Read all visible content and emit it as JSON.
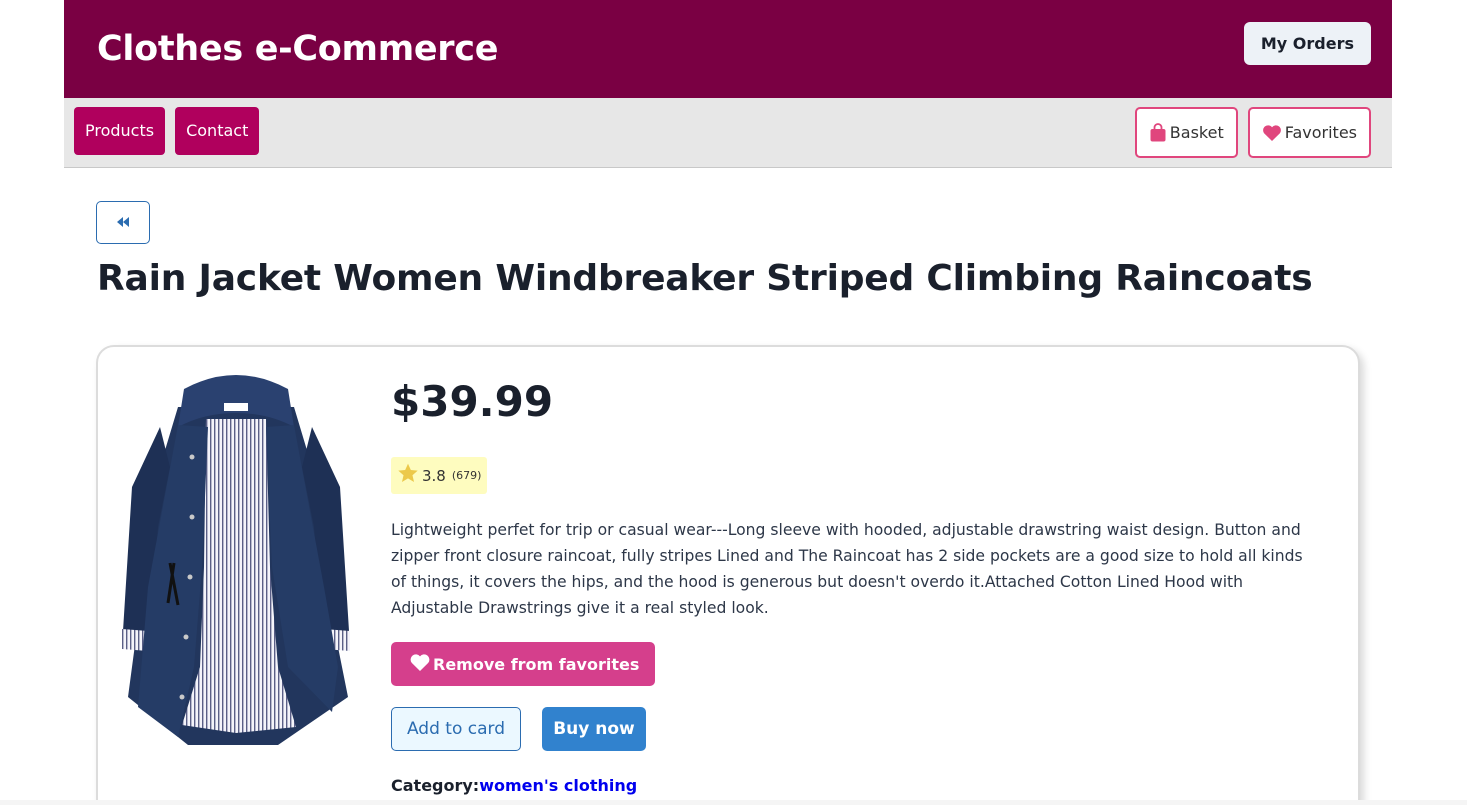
{
  "header": {
    "brand": "Clothes e-Commerce",
    "orders_label": "My Orders"
  },
  "nav": {
    "items": [
      {
        "label": "Products"
      },
      {
        "label": "Contact"
      }
    ],
    "basket_label": "Basket",
    "favorites_label": "Favorites"
  },
  "product": {
    "back_icon": "double-chevron-left-icon",
    "title": "Rain Jacket Women Windbreaker Striped Climbing Raincoats",
    "price": "$39.99",
    "rating": "3.8",
    "rating_count": "(679)",
    "description": "Lightweight perfet for trip or casual wear---Long sleeve with hooded, adjustable drawstring waist design. Button and zipper front closure raincoat, fully stripes Lined and The Raincoat has 2 side pockets are a good size to hold all kinds of things, it covers the hips, and the hood is generous but doesn't overdo it.Attached Cotton Lined Hood with Adjustable Drawstrings give it a real styled look.",
    "remove_fav_label": "Remove from favorites",
    "add_to_card_label": "Add to card",
    "buy_now_label": "Buy now",
    "category_label": "Category:",
    "category_value": "women's clothing"
  },
  "colors": {
    "header_bg": "#7a0043",
    "nav_button": "#b0005d",
    "accent_pink": "#e0467d",
    "fav_button": "#d53f8c",
    "buy_button": "#3182ce",
    "rating_bg": "#fefcbf"
  }
}
